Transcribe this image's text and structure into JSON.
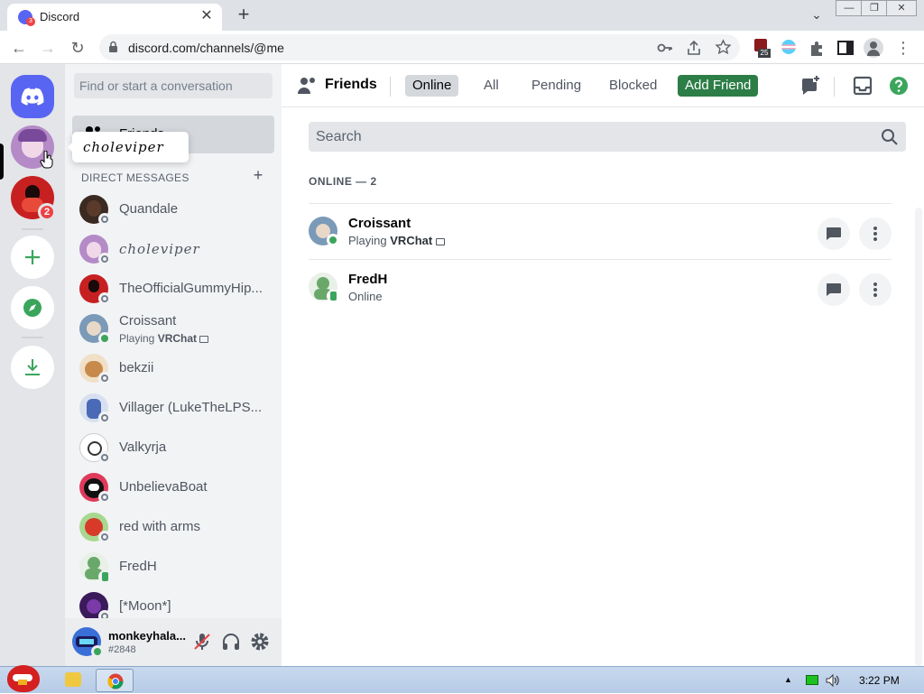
{
  "browser": {
    "tab_title": "Discord",
    "tab_badge": "3",
    "url": "discord.com/channels/@me",
    "extension_badge": "25"
  },
  "servers": {
    "badge_count": "2"
  },
  "dm_list": {
    "search_placeholder": "Find or start a conversation",
    "friends_label": "Friends",
    "section_title": "DIRECT MESSAGES",
    "tooltip": "choleviper",
    "items": [
      {
        "name": "Quandale",
        "status": "offline",
        "color": "#3a2a22"
      },
      {
        "name": "choleviper",
        "status": "offline",
        "color": "#b48ac7"
      },
      {
        "name": "TheOfficialGummyHip...",
        "status": "offline",
        "color": "#c72020"
      },
      {
        "name": "Croissant",
        "status": "online",
        "activity_prefix": "Playing",
        "activity_game": "VRChat",
        "color": "#7a9ab8"
      },
      {
        "name": "bekzii",
        "status": "offline",
        "color": "#c88a4a"
      },
      {
        "name": "Villager (LukeTheLPS...",
        "status": "offline",
        "color": "#4a6ab8"
      },
      {
        "name": "Valkyrja",
        "status": "offline",
        "color": "#d8d8d0"
      },
      {
        "name": "UnbelievaBoat",
        "status": "offline",
        "color": "#e03a5a"
      },
      {
        "name": "red with arms",
        "status": "offline",
        "color": "#d83a2a"
      },
      {
        "name": "FredH",
        "status": "mobile",
        "color": "#6aa86a"
      },
      {
        "name": "[*Moon*]",
        "status": "offline",
        "color": "#3a1a5a"
      }
    ]
  },
  "user": {
    "name": "monkeyhala...",
    "tag": "#2848"
  },
  "main": {
    "title": "Friends",
    "tabs": [
      "Online",
      "All",
      "Pending",
      "Blocked"
    ],
    "add_friend": "Add Friend",
    "search_placeholder": "Search",
    "online_header": "ONLINE — 2",
    "friends": [
      {
        "name": "Croissant",
        "status_prefix": "Playing",
        "status_game": "VRChat",
        "color": "#7a9ab8"
      },
      {
        "name": "FredH",
        "status_text": "Online",
        "color": "#6aa86a"
      }
    ]
  },
  "taskbar": {
    "time": "3:22 PM"
  },
  "colors": {
    "blurple": "#5865f2",
    "green": "#3ba55c",
    "add_friend": "#2d7d46",
    "red_badge": "#ed4245"
  }
}
